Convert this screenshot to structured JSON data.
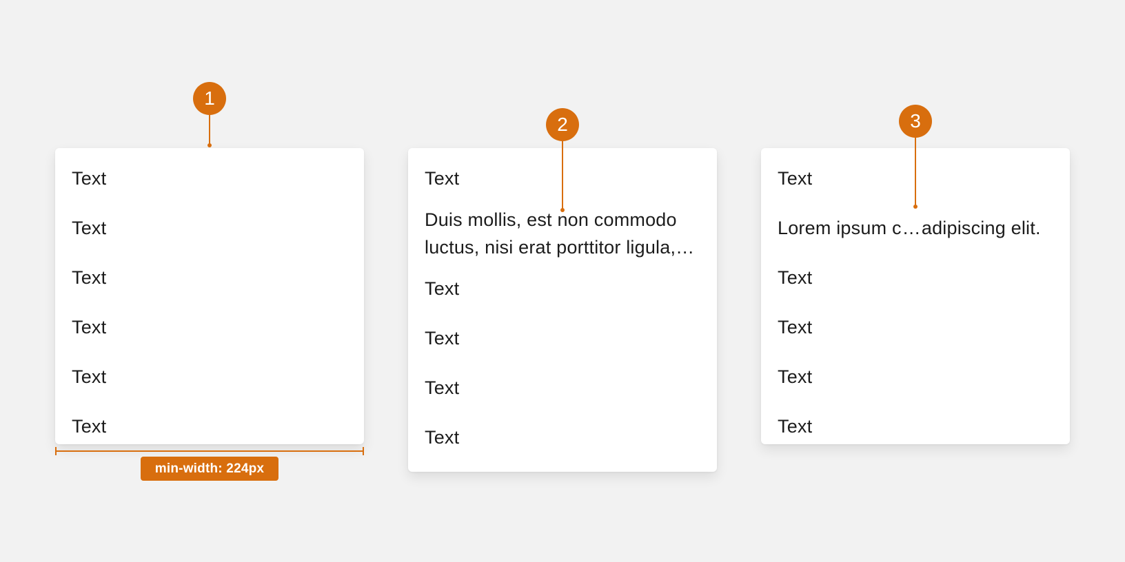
{
  "accent_color": "#d86e0e",
  "markers": [
    "1",
    "2",
    "3"
  ],
  "dimension_label": "min-width: 224px",
  "menu1": {
    "items": [
      "Text",
      "Text",
      "Text",
      "Text",
      "Text",
      "Text"
    ]
  },
  "menu2": {
    "item_first": "Text",
    "wrapped_item": "Duis mollis, est non commodo luctus, nisi erat porttitor ligula, eget lacinia odio sem nec elit.",
    "items_after": [
      "Text",
      "Text",
      "Text",
      "Text"
    ]
  },
  "menu3": {
    "item_first": "Text",
    "truncated_item_start": "Lorem ipsum c",
    "truncated_ellipsis": "…",
    "truncated_item_end": "adipiscing elit.",
    "items_after": [
      "Text",
      "Text",
      "Text",
      "Text"
    ]
  }
}
